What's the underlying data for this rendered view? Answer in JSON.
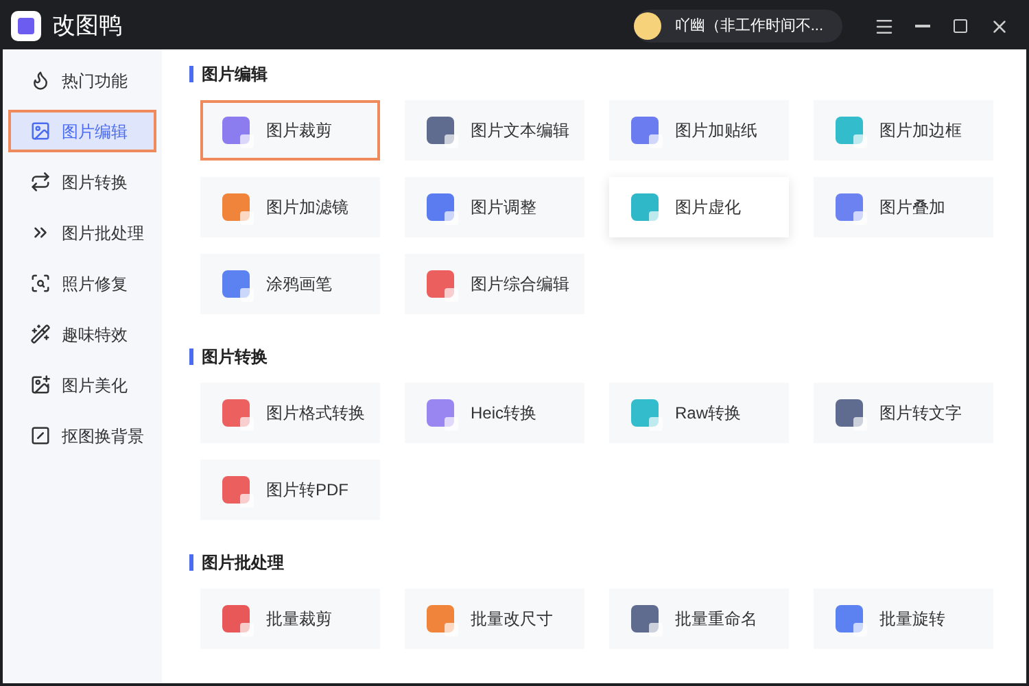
{
  "window": {
    "title": "改图鸭"
  },
  "user": {
    "name": "吖幽（非工作时间不..."
  },
  "sidebar": {
    "items": [
      {
        "label": "热门功能",
        "selected": false
      },
      {
        "label": "图片编辑",
        "selected": true
      },
      {
        "label": "图片转换",
        "selected": false
      },
      {
        "label": "图片批处理",
        "selected": false
      },
      {
        "label": "照片修复",
        "selected": false
      },
      {
        "label": "趣味特效",
        "selected": false
      },
      {
        "label": "图片美化",
        "selected": false
      },
      {
        "label": "抠图换背景",
        "selected": false
      }
    ]
  },
  "sections": [
    {
      "title": "图片编辑",
      "tools": [
        {
          "label": "图片裁剪",
          "color": "#8b7cf0",
          "selected": true,
          "highlighted": false
        },
        {
          "label": "图片文本编辑",
          "color": "#5f6b8f",
          "selected": false,
          "highlighted": false
        },
        {
          "label": "图片加贴纸",
          "color": "#6b7cf0",
          "selected": false,
          "highlighted": false
        },
        {
          "label": "图片加边框",
          "color": "#33bccc",
          "selected": false,
          "highlighted": false
        },
        {
          "label": "图片加滤镜",
          "color": "#f0843a",
          "selected": false,
          "highlighted": false
        },
        {
          "label": "图片调整",
          "color": "#5b7cf0",
          "selected": false,
          "highlighted": false
        },
        {
          "label": "图片虚化",
          "color": "#2fb8c8",
          "selected": false,
          "highlighted": true
        },
        {
          "label": "图片叠加",
          "color": "#6b82f0",
          "selected": false,
          "highlighted": false
        },
        {
          "label": "涂鸦画笔",
          "color": "#5b82f0",
          "selected": false,
          "highlighted": false
        },
        {
          "label": "图片综合编辑",
          "color": "#ec5f5f",
          "selected": false,
          "highlighted": false
        }
      ]
    },
    {
      "title": "图片转换",
      "tools": [
        {
          "label": "图片格式转换",
          "color": "#ec6060",
          "selected": false,
          "highlighted": false
        },
        {
          "label": "Heic转换",
          "color": "#9a86f0",
          "selected": false,
          "highlighted": false
        },
        {
          "label": "Raw转换",
          "color": "#33bccc",
          "selected": false,
          "highlighted": false
        },
        {
          "label": "图片转文字",
          "color": "#5f6b8f",
          "selected": false,
          "highlighted": false
        },
        {
          "label": "图片转PDF",
          "color": "#ec5f5f",
          "selected": false,
          "highlighted": false
        }
      ]
    },
    {
      "title": "图片批处理",
      "tools": [
        {
          "label": "批量裁剪",
          "color": "#e85858",
          "selected": false,
          "highlighted": false
        },
        {
          "label": "批量改尺寸",
          "color": "#f0843a",
          "selected": false,
          "highlighted": false
        },
        {
          "label": "批量重命名",
          "color": "#5f6b8f",
          "selected": false,
          "highlighted": false
        },
        {
          "label": "批量旋转",
          "color": "#5b82f0",
          "selected": false,
          "highlighted": false
        }
      ]
    }
  ]
}
